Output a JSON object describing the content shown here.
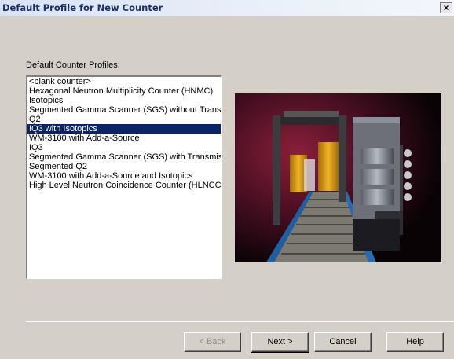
{
  "window": {
    "title": "Default Profile for New Counter",
    "close_label": "×"
  },
  "profiles": {
    "label": "Default Counter Profiles:",
    "items": [
      "<blank counter>",
      "Hexagonal Neutron Multiplicity Counter (HNMC)",
      "Isotopics",
      "Segmented Gamma Scanner (SGS) without Transmission",
      "Q2",
      "IQ3 with Isotopics",
      "WM-3100 with Add-a-Source",
      "IQ3",
      "Segmented Gamma Scanner (SGS) with Transmission",
      "Segmented Q2",
      "WM-3100 with Add-a-Source and Isotopics",
      "High Level Neutron Coincidence Counter (HLNCC)"
    ],
    "selected": "IQ3 with Isotopics"
  },
  "buttons": {
    "back": "< Back",
    "next": "Next >",
    "cancel": "Cancel",
    "help": "Help"
  },
  "colors": {
    "selection": "#0a246a",
    "dialog": "#d4d0c8",
    "title_text": "#1f2f66"
  },
  "icons": {
    "close": "close-icon",
    "preview": "counter-photo"
  }
}
